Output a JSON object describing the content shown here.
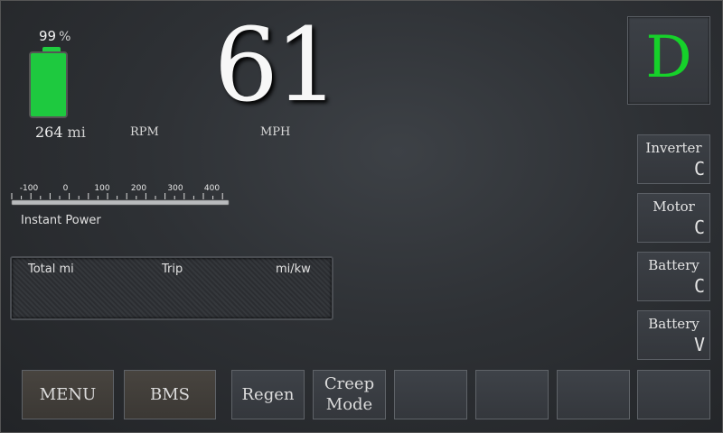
{
  "battery": {
    "percent": 99,
    "percent_text": "99",
    "percent_unit": "%",
    "range_value": "264",
    "range_unit": "mi",
    "color": "#1ec93f"
  },
  "gauges": {
    "rpm_label": "RPM",
    "speed": "61",
    "speed_label": "MPH"
  },
  "gear": {
    "value": "D",
    "color": "#16d12a"
  },
  "tiles": [
    {
      "label": "Inverter",
      "value": "C"
    },
    {
      "label": "Motor",
      "value": "C"
    },
    {
      "label": "Battery",
      "value": "C"
    },
    {
      "label": "Battery",
      "value": "V"
    }
  ],
  "power": {
    "label": "Instant Power",
    "ticks": [
      "-100",
      "0",
      "100",
      "200",
      "300",
      "400"
    ]
  },
  "trip": {
    "total_label": "Total mi",
    "trip_label": "Trip",
    "efficiency_label": "mi/kw"
  },
  "buttons": [
    {
      "label": "MENU"
    },
    {
      "label": "BMS"
    },
    {
      "label": "Regen"
    },
    {
      "label_line1": "Creep",
      "label_line2": "Mode"
    },
    {
      "label": ""
    },
    {
      "label": ""
    },
    {
      "label": ""
    },
    {
      "label": ""
    }
  ]
}
